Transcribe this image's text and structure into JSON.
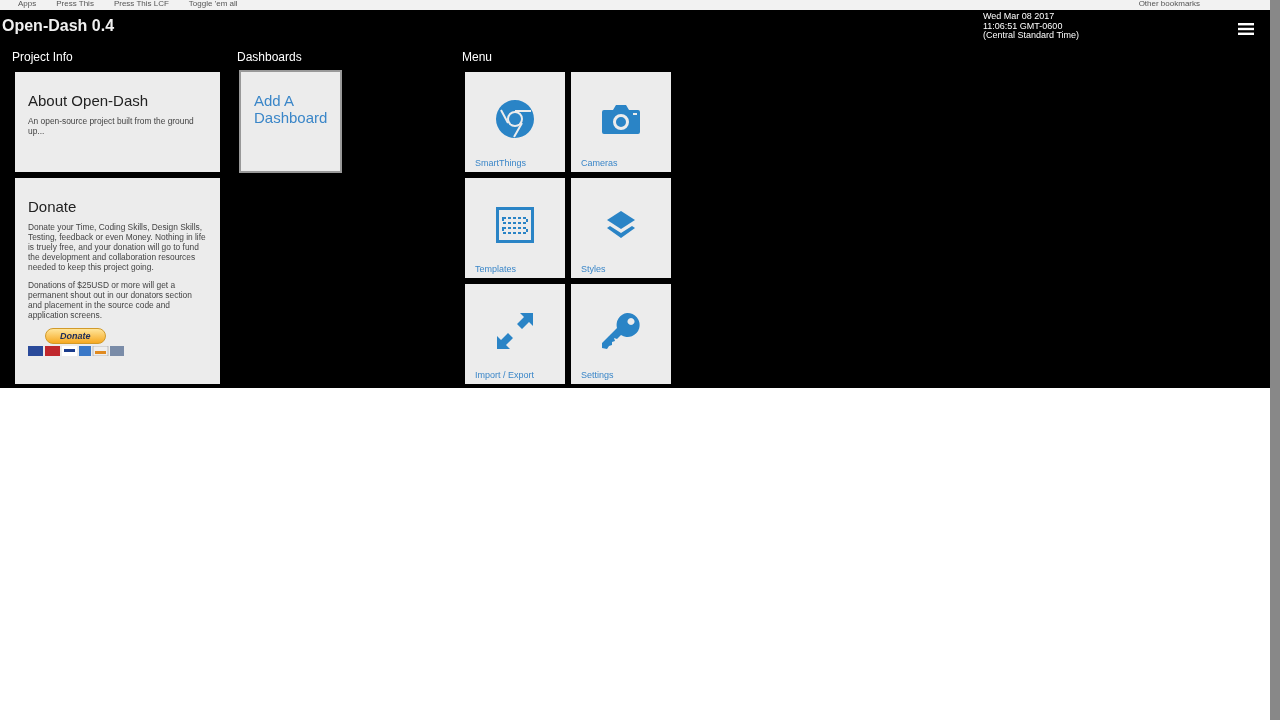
{
  "bookmarks_bar": {
    "items": [
      "Apps",
      "Press This",
      "Press This LCF",
      "Toggle 'em all"
    ],
    "other": "Other bookmarks"
  },
  "header": {
    "title": "Open-Dash 0.4",
    "datetime": [
      "Wed Mar 08 2017",
      "11:06:51 GMT-0600",
      "(Central Standard Time)"
    ]
  },
  "project_info": {
    "heading": "Project Info",
    "about": {
      "title": "About Open-Dash",
      "text": "An open-source project built from the ground up..."
    },
    "donate": {
      "title": "Donate",
      "paragraphs": [
        "Donate your Time, Coding Skills, Design Skills, Testing, feedback or even Money. Nothing in life is truely free, and your donation will go to fund the development and collaboration resources needed to keep this project going.",
        "Donations of $25USD or more will get a permanent shout out in our donators section and placement in the source code and application screens."
      ],
      "button": "Donate"
    }
  },
  "dashboards": {
    "heading": "Dashboards",
    "add_tile": "Add A Dashboard"
  },
  "menu": {
    "heading": "Menu",
    "tiles": [
      {
        "label": "SmartThings"
      },
      {
        "label": "Cameras"
      },
      {
        "label": "Templates"
      },
      {
        "label": "Styles"
      },
      {
        "label": "Import / Export"
      },
      {
        "label": "Settings"
      }
    ]
  }
}
